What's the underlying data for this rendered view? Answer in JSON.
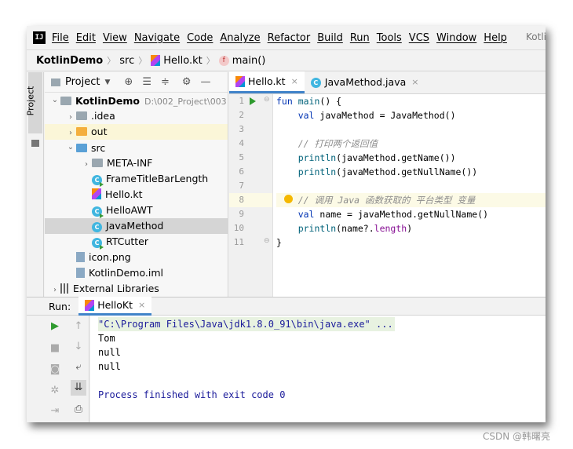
{
  "menubar": {
    "logo": "IJ",
    "items": [
      "File",
      "Edit",
      "View",
      "Navigate",
      "Code",
      "Analyze",
      "Refactor",
      "Build",
      "Run",
      "Tools",
      "VCS",
      "Window",
      "Help"
    ],
    "title_partial": "Kotli"
  },
  "navbar": {
    "project": "KotlinDemo",
    "folder": "src",
    "file": "Hello.kt",
    "function": "main()"
  },
  "left_tool": {
    "project_tab": "Project"
  },
  "project_panel": {
    "view_label": "Project",
    "tree": [
      {
        "indent": 0,
        "arrow": "⌄",
        "icon": "folder-grey",
        "label": "KotlinDemo",
        "tail": "D:\\002_Project\\003"
      },
      {
        "indent": 1,
        "arrow": "›",
        "icon": "folder-grey",
        "label": ".idea"
      },
      {
        "indent": 1,
        "arrow": "›",
        "icon": "folder-orange",
        "label": "out"
      },
      {
        "indent": 1,
        "arrow": "⌄",
        "icon": "folder-blue",
        "label": "src"
      },
      {
        "indent": 2,
        "arrow": "›",
        "icon": "folder-grey",
        "label": "META-INF"
      },
      {
        "indent": 2,
        "arrow": "",
        "icon": "class-run",
        "label": "FrameTitleBarLength"
      },
      {
        "indent": 2,
        "arrow": "",
        "icon": "kotlin-file",
        "label": "Hello.kt"
      },
      {
        "indent": 2,
        "arrow": "",
        "icon": "class-run",
        "label": "HelloAWT"
      },
      {
        "indent": 2,
        "arrow": "",
        "icon": "class",
        "label": "JavaMethod"
      },
      {
        "indent": 2,
        "arrow": "",
        "icon": "class-run",
        "label": "RTCutter"
      },
      {
        "indent": 1,
        "arrow": "",
        "icon": "image-file",
        "label": "icon.png"
      },
      {
        "indent": 1,
        "arrow": "",
        "icon": "module-file",
        "label": "KotlinDemo.iml"
      },
      {
        "indent": 0,
        "arrow": "›",
        "icon": "library",
        "label": "External Libraries"
      }
    ]
  },
  "editor": {
    "tabs": [
      {
        "label": "Hello.kt",
        "close": "×"
      },
      {
        "label": "JavaMethod.java",
        "close": "×"
      }
    ],
    "line_numbers": [
      "1",
      "2",
      "3",
      "4",
      "5",
      "6",
      "7",
      "8",
      "9",
      "10",
      "11"
    ],
    "lines": [
      [
        [
          "kw",
          "fun "
        ],
        [
          "fn",
          "main"
        ],
        [
          "",
          "() {"
        ]
      ],
      [
        [
          "",
          "    "
        ],
        [
          "kw",
          "val "
        ],
        [
          "",
          "javaMethod = JavaMethod()"
        ]
      ],
      [
        [
          "",
          ""
        ]
      ],
      [
        [
          "",
          "    "
        ],
        [
          "cm",
          "// 打印两个返回值"
        ]
      ],
      [
        [
          "",
          "    "
        ],
        [
          "fn",
          "println"
        ],
        [
          "",
          "(javaMethod.getName())"
        ]
      ],
      [
        [
          "",
          "    "
        ],
        [
          "fn",
          "println"
        ],
        [
          "",
          "(javaMethod.getNullName())"
        ]
      ],
      [
        [
          "",
          ""
        ]
      ],
      [
        [
          "",
          "    "
        ],
        [
          "cm",
          "// 调用 Java 函数获取的 平台类型 变量"
        ]
      ],
      [
        [
          "",
          "    "
        ],
        [
          "kw",
          "val "
        ],
        [
          "",
          "name = javaMethod.getNullName()"
        ]
      ],
      [
        [
          "",
          "    "
        ],
        [
          "fn",
          "println"
        ],
        [
          "",
          "(name?."
        ],
        [
          "pr",
          "length"
        ],
        [
          "",
          ")"
        ]
      ],
      [
        [
          "",
          "}"
        ]
      ]
    ]
  },
  "run_panel": {
    "label": "Run:",
    "tab": "HelloKt",
    "tab_close": "×",
    "output": [
      "\"C:\\Program Files\\Java\\jdk1.8.0_91\\bin\\java.exe\" ...",
      "Tom",
      "null",
      "null",
      "",
      "Process finished with exit code 0"
    ]
  },
  "watermark": "CSDN @韩曙亮"
}
